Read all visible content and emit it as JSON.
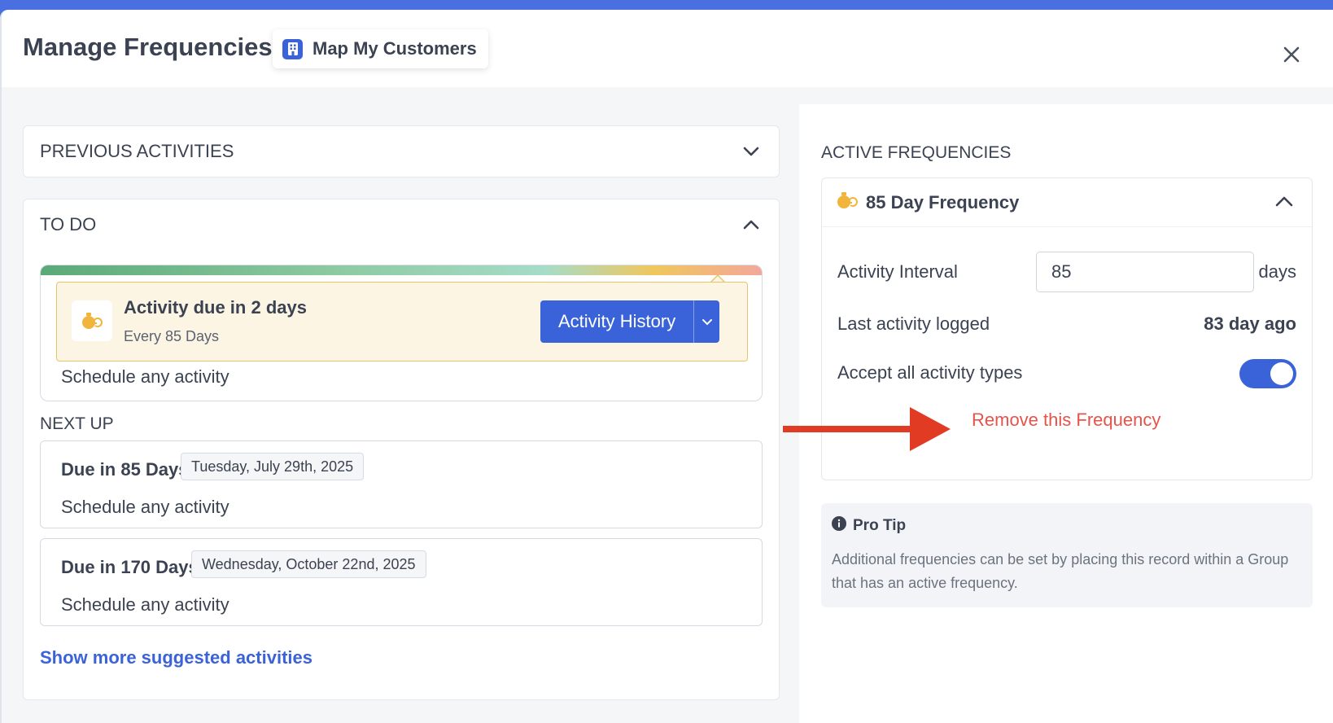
{
  "header": {
    "title": "Manage Frequencies",
    "badge_label": "Map My Customers"
  },
  "previous_activities": {
    "label": "PREVIOUS ACTIVITIES"
  },
  "todo": {
    "label": "TO DO",
    "current": {
      "title": "Activity due in 2 days",
      "subtitle": "Every 85 Days",
      "button_label": "Activity History",
      "schedule": "Schedule any activity"
    },
    "next_up_label": "NEXT UP",
    "next_up": [
      {
        "title": "Due in 85 Days",
        "date": "Tuesday, July 29th, 2025",
        "schedule": "Schedule any activity"
      },
      {
        "title": "Due in 170 Days",
        "date": "Wednesday, October 22nd, 2025",
        "schedule": "Schedule any activity"
      }
    ],
    "show_more": "Show more suggested activities"
  },
  "active_frequencies": {
    "title": "ACTIVE FREQUENCIES",
    "frequency": {
      "name": "85 Day Frequency",
      "interval_label": "Activity Interval",
      "interval_value": "85",
      "interval_unit": "days",
      "last_logged_label": "Last activity logged",
      "last_logged_value": "83 day ago",
      "accept_label": "Accept all activity types",
      "accept_on": true,
      "remove_label": "Remove this Frequency"
    }
  },
  "pro_tip": {
    "title": "Pro Tip",
    "text": "Additional frequencies can be set by placing this record within a Group that has an active frequency."
  },
  "colors": {
    "accent": "#3b63d9",
    "danger": "#e5534b",
    "arrow": "#e23b24",
    "due_bg": "#fdf5e4"
  }
}
